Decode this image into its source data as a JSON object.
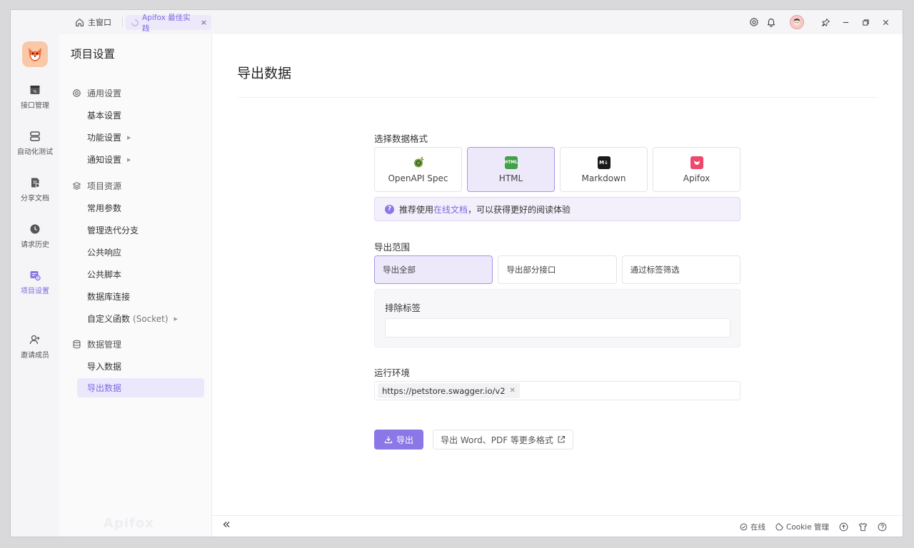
{
  "titlebar": {
    "home_tab": "主窗口",
    "active_tab": "Apifox 最佳实践",
    "close_glyph": "×"
  },
  "rail": {
    "items": [
      {
        "label": "接口管理",
        "icon": "api-icon"
      },
      {
        "label": "自动化测试",
        "icon": "automation-icon"
      },
      {
        "label": "分享文档",
        "icon": "share-doc-icon"
      },
      {
        "label": "请求历史",
        "icon": "history-icon"
      },
      {
        "label": "项目设置",
        "icon": "project-settings-icon"
      },
      {
        "label": "邀请成员",
        "icon": "invite-member-icon"
      }
    ]
  },
  "sidebar": {
    "title": "项目设置",
    "groups": [
      {
        "label": "通用设置",
        "items": [
          "基本设置",
          "功能设置",
          "通知设置"
        ]
      },
      {
        "label": "项目资源",
        "items": [
          "常用参数",
          "管理迭代分支",
          "公共响应",
          "公共脚本",
          "数据库连接",
          "自定义函数",
          "(Socket)"
        ]
      },
      {
        "label": "数据管理",
        "items": [
          "导入数据",
          "导出数据"
        ]
      }
    ],
    "watermark": "Apifox"
  },
  "main": {
    "title": "导出数据",
    "format_label": "选择数据格式",
    "formats": [
      "OpenAPI Spec",
      "HTML",
      "Markdown",
      "Apifox"
    ],
    "selected_format": "HTML",
    "notice": {
      "prefix": "推荐使用",
      "link": "在线文档",
      "suffix": "，可以获得更好的阅读体验"
    },
    "scope_label": "导出范围",
    "scopes": [
      "导出全部",
      "导出部分接口",
      "通过标签筛选"
    ],
    "exclude_label": "排除标签",
    "exclude_value": "",
    "env_label": "运行环境",
    "env_tag": "https://petstore.swagger.io/v2",
    "export_button": "导出",
    "more_button": "导出 Word、PDF 等更多格式"
  },
  "statusbar": {
    "online": "在线",
    "cookie": "Cookie 管理"
  },
  "colors": {
    "accent": "#8b78e6",
    "accent_bg": "#ede9fb"
  }
}
